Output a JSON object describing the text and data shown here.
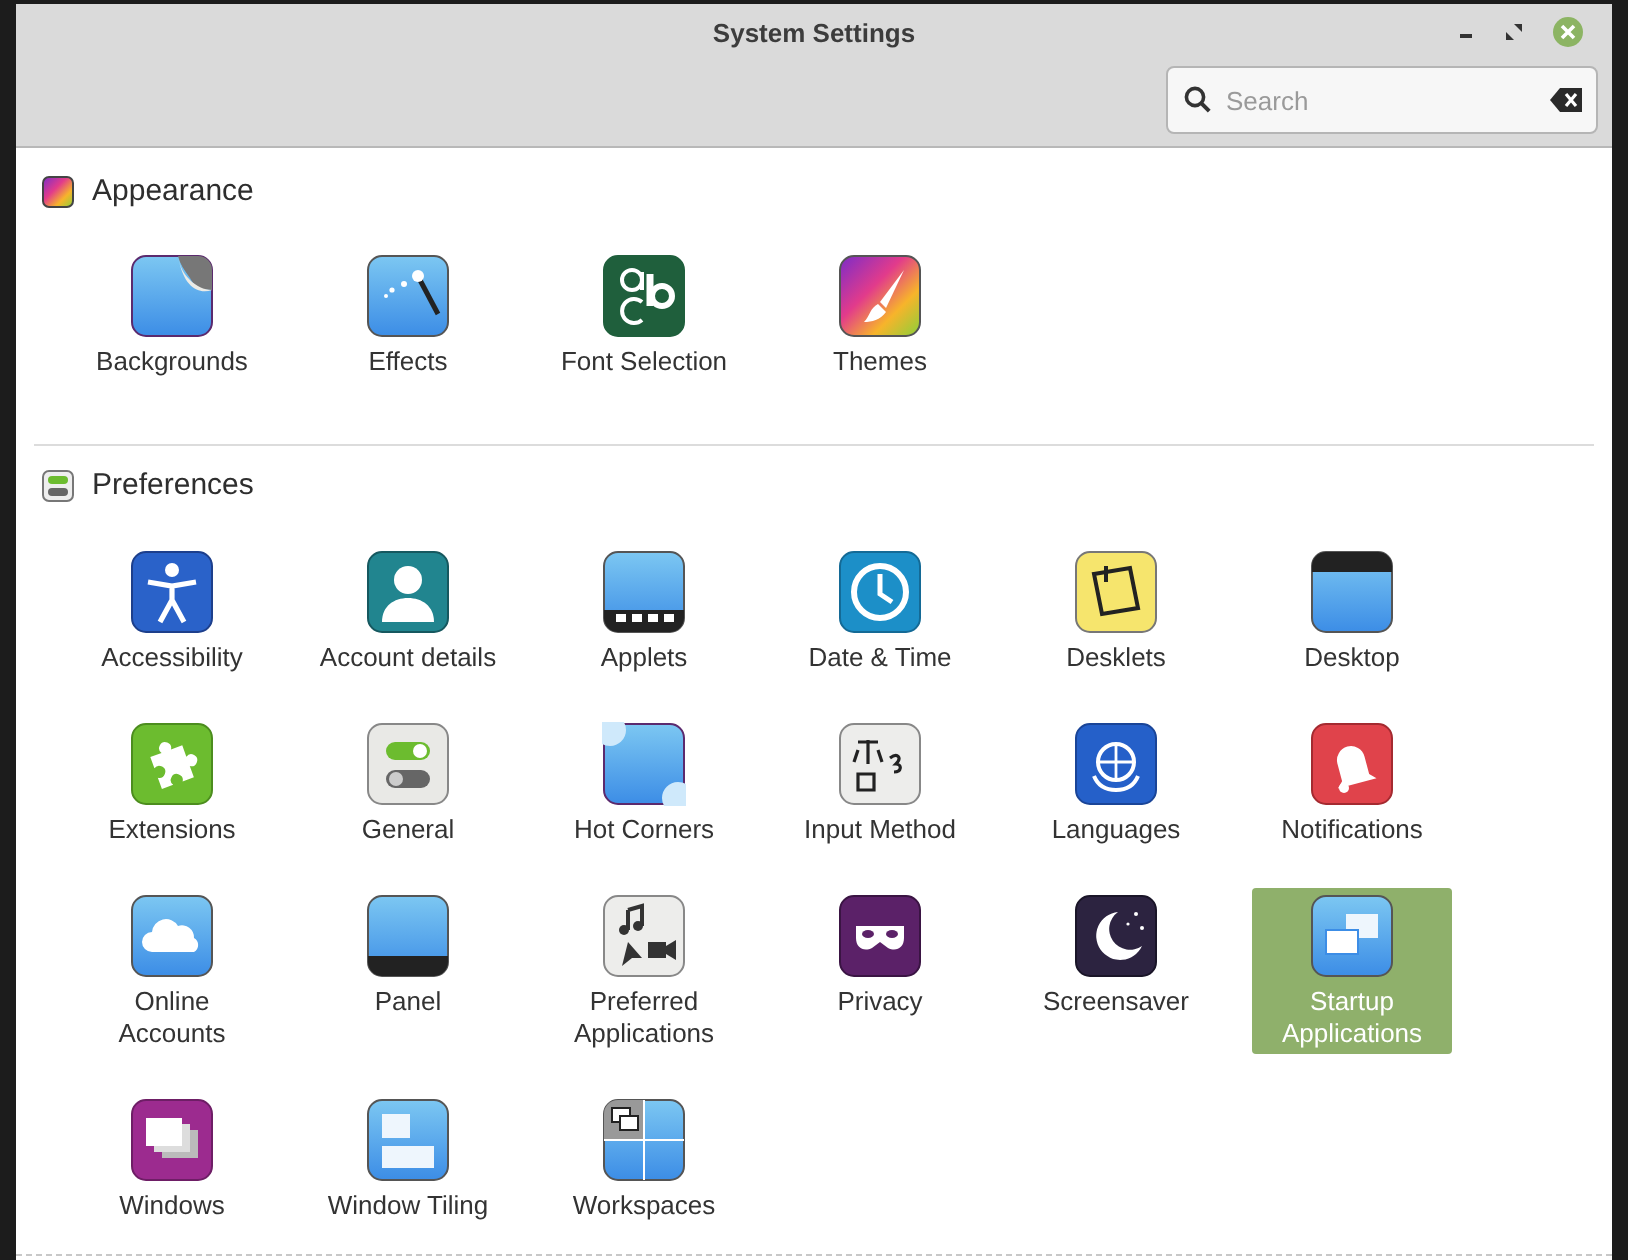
{
  "window": {
    "title": "System Settings"
  },
  "search": {
    "placeholder": "Search"
  },
  "sections": [
    {
      "title": "Appearance",
      "items": [
        {
          "label": "Backgrounds",
          "selected": false
        },
        {
          "label": "Effects",
          "selected": false
        },
        {
          "label": "Font Selection",
          "selected": false
        },
        {
          "label": "Themes",
          "selected": false
        }
      ]
    },
    {
      "title": "Preferences",
      "items": [
        {
          "label": "Accessibility",
          "selected": false
        },
        {
          "label": "Account details",
          "selected": false
        },
        {
          "label": "Applets",
          "selected": false
        },
        {
          "label": "Date & Time",
          "selected": false
        },
        {
          "label": "Desklets",
          "selected": false
        },
        {
          "label": "Desktop",
          "selected": false
        },
        {
          "label": "Extensions",
          "selected": false
        },
        {
          "label": "General",
          "selected": false
        },
        {
          "label": "Hot Corners",
          "selected": false
        },
        {
          "label": "Input Method",
          "selected": false
        },
        {
          "label": "Languages",
          "selected": false
        },
        {
          "label": "Notifications",
          "selected": false
        },
        {
          "label": "Online\nAccounts",
          "selected": false
        },
        {
          "label": "Panel",
          "selected": false
        },
        {
          "label": "Preferred\nApplications",
          "selected": false
        },
        {
          "label": "Privacy",
          "selected": false
        },
        {
          "label": "Screensaver",
          "selected": false
        },
        {
          "label": "Startup\nApplications",
          "selected": true
        },
        {
          "label": "Windows",
          "selected": false
        },
        {
          "label": "Window Tiling",
          "selected": false
        },
        {
          "label": "Workspaces",
          "selected": false
        }
      ]
    }
  ]
}
